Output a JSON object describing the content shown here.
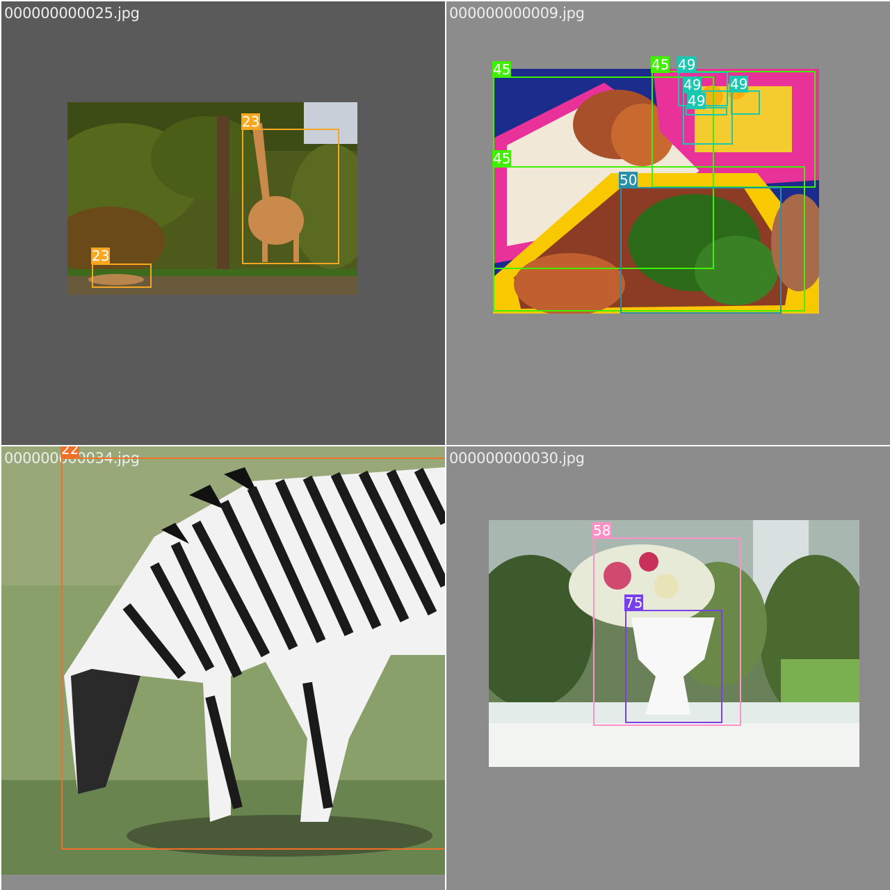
{
  "tiles": [
    {
      "filename": "000000000025.jpg",
      "labels": [
        "23",
        "23"
      ]
    },
    {
      "filename": "000000000009.jpg",
      "labels": [
        "45",
        "45",
        "49",
        "49",
        "49",
        "49",
        "45",
        "50"
      ]
    },
    {
      "filename": "000000000034.jpg",
      "labels": [
        "22"
      ]
    },
    {
      "filename": "000000000030.jpg",
      "labels": [
        "58",
        "75"
      ]
    }
  ],
  "class_colors": {
    "22": "#f07028",
    "23": "#f8a820",
    "45": "#40f000",
    "49": "#18c8b0",
    "50": "#2890a8",
    "58": "#ff90c8",
    "75": "#7840e8"
  },
  "backgrounds": {
    "tile1": "#5a5a5a",
    "tile2": "#8c8c8c",
    "tile3": "#8c8c8c",
    "tile4": "#8c8c8c"
  }
}
